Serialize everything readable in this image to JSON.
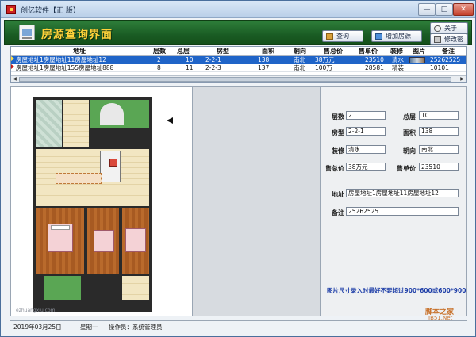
{
  "window": {
    "title": "创亿软件【正 版】",
    "min_label": "—",
    "max_label": "□",
    "close_label": "✕"
  },
  "header": {
    "title": "房源查询界面",
    "query_label": "查询",
    "add_label": "增加房源",
    "about_label": "关于",
    "password_label": "修改密码"
  },
  "table": {
    "columns": [
      "地址",
      "层数",
      "总层",
      "房型",
      "面积",
      "朝向",
      "售总价",
      "售单价",
      "装修",
      "图片",
      "备注"
    ],
    "rows": [
      {
        "address": "房屋地址1房屋地址11房屋地址12",
        "floor": "2",
        "total": "10",
        "type": "2-2-1",
        "area": "138",
        "orient": "南北",
        "total_price": "38万元",
        "unit_price": "23510",
        "decor": "清水",
        "note": "25262525"
      },
      {
        "address": "房屋地址1房屋地址155房屋地址888",
        "floor": "8",
        "total": "11",
        "type": "2-2-3",
        "area": "137",
        "orient": "南北",
        "total_price": "100万",
        "unit_price": "28581",
        "decor": "精装",
        "note": "10101"
      }
    ]
  },
  "form": {
    "floor_label": "层数",
    "floor_value": "2",
    "total_label": "总层",
    "total_value": "10",
    "type_label": "房型",
    "type_value": "2-2-1",
    "area_label": "面积",
    "area_value": "138",
    "decor_label": "装修",
    "decor_value": "清水",
    "orient_label": "朝向",
    "orient_value": "南北",
    "total_price_label": "售总价",
    "total_price_value": "38万元",
    "unit_price_label": "售单价",
    "unit_price_value": "23510",
    "address_label": "地址",
    "address_value": "房屋地址1房屋地址11房屋地址12",
    "note_label": "备注",
    "note_value": "25262525",
    "hint": "图片尺寸录入时最好不要超过900*600或600*900"
  },
  "image": {
    "watermark": "ezhuangxiu.com"
  },
  "status": {
    "date": "2019年03月25日",
    "weekday": "星期一",
    "operator": "操作员：系统管理员"
  },
  "logo": {
    "name": "脚本之家",
    "url": "JB51.Net"
  },
  "colors": {
    "header_green": "#1a5c24",
    "header_title": "#ffd23a",
    "selected_row": "#1f64c8",
    "hint_blue": "#1f3fa8"
  }
}
